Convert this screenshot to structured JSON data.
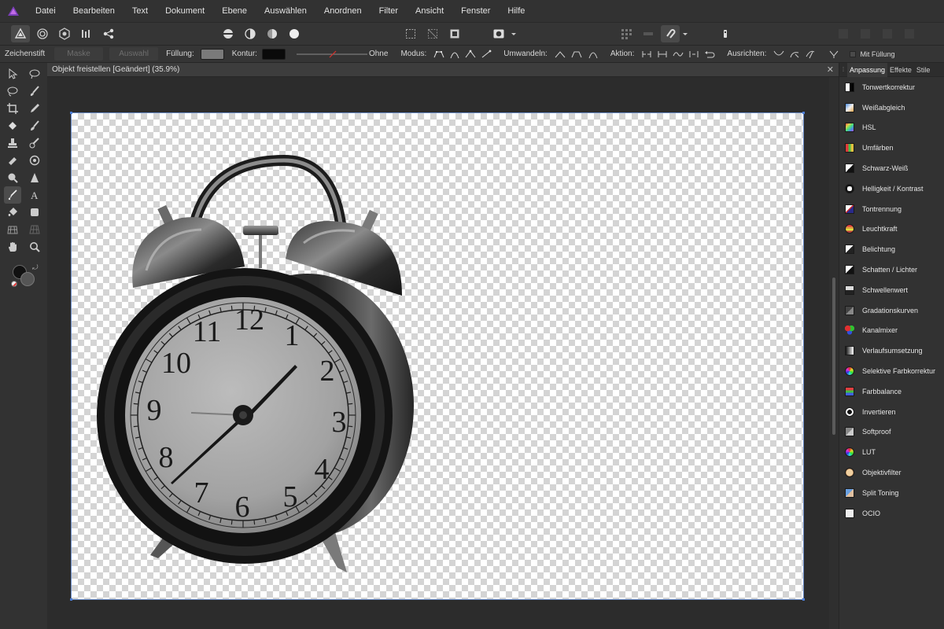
{
  "menu": [
    "Datei",
    "Bearbeiten",
    "Text",
    "Dokument",
    "Ebene",
    "Auswählen",
    "Anordnen",
    "Filter",
    "Ansicht",
    "Fenster",
    "Hilfe"
  ],
  "context_bar": {
    "tool_name": "Zeichenstift",
    "mask_label": "Maske",
    "selection_label": "Auswahl",
    "fill_label": "Füllung:",
    "stroke_label": "Kontur:",
    "stroke_value": "Ohne",
    "mode_label": "Modus:",
    "convert_label": "Umwandeln:",
    "action_label": "Aktion:",
    "align_label": "Ausrichten:",
    "with_fill_label": "Mit Füllung",
    "fill_color": "#7a7a7a",
    "stroke_color": "#0a0a0a"
  },
  "document": {
    "tab_title": "Objekt freistellen [Geändert] (35.9%)",
    "close": "✕"
  },
  "right_panel": {
    "tabs": [
      "Anpassung",
      "Effekte",
      "Stile"
    ],
    "active_tab": "Anpassung",
    "adjustments": [
      {
        "label": "Tonwertkorrektur",
        "icon": "levels-icon"
      },
      {
        "label": "Weißabgleich",
        "icon": "white-balance-icon"
      },
      {
        "label": "HSL",
        "icon": "hsl-icon"
      },
      {
        "label": "Umfärben",
        "icon": "recolor-icon"
      },
      {
        "label": "Schwarz-Weiß",
        "icon": "black-white-icon"
      },
      {
        "label": "Helligkeit / Kontrast",
        "icon": "brightness-contrast-icon"
      },
      {
        "label": "Tontrennung",
        "icon": "posterize-icon"
      },
      {
        "label": "Leuchtkraft",
        "icon": "vibrance-icon"
      },
      {
        "label": "Belichtung",
        "icon": "exposure-icon"
      },
      {
        "label": "Schatten / Lichter",
        "icon": "shadows-highlights-icon"
      },
      {
        "label": "Schwellenwert",
        "icon": "threshold-icon"
      },
      {
        "label": "Gradationskurven",
        "icon": "curves-icon"
      },
      {
        "label": "Kanalmixer",
        "icon": "channel-mixer-icon"
      },
      {
        "label": "Verlaufsumsetzung",
        "icon": "gradient-map-icon"
      },
      {
        "label": "Selektive Farbkorrektur",
        "icon": "selective-color-icon"
      },
      {
        "label": "Farbbalance",
        "icon": "color-balance-icon"
      },
      {
        "label": "Invertieren",
        "icon": "invert-icon"
      },
      {
        "label": "Softproof",
        "icon": "soft-proof-icon"
      },
      {
        "label": "LUT",
        "icon": "lut-icon"
      },
      {
        "label": "Objektivfilter",
        "icon": "lens-filter-icon"
      },
      {
        "label": "Split Toning",
        "icon": "split-toning-icon"
      },
      {
        "label": "OCIO",
        "icon": "ocio-icon"
      }
    ]
  },
  "clock_numbers": [
    "12",
    "1",
    "2",
    "3",
    "4",
    "5",
    "6",
    "7",
    "8",
    "9",
    "10",
    "11"
  ]
}
